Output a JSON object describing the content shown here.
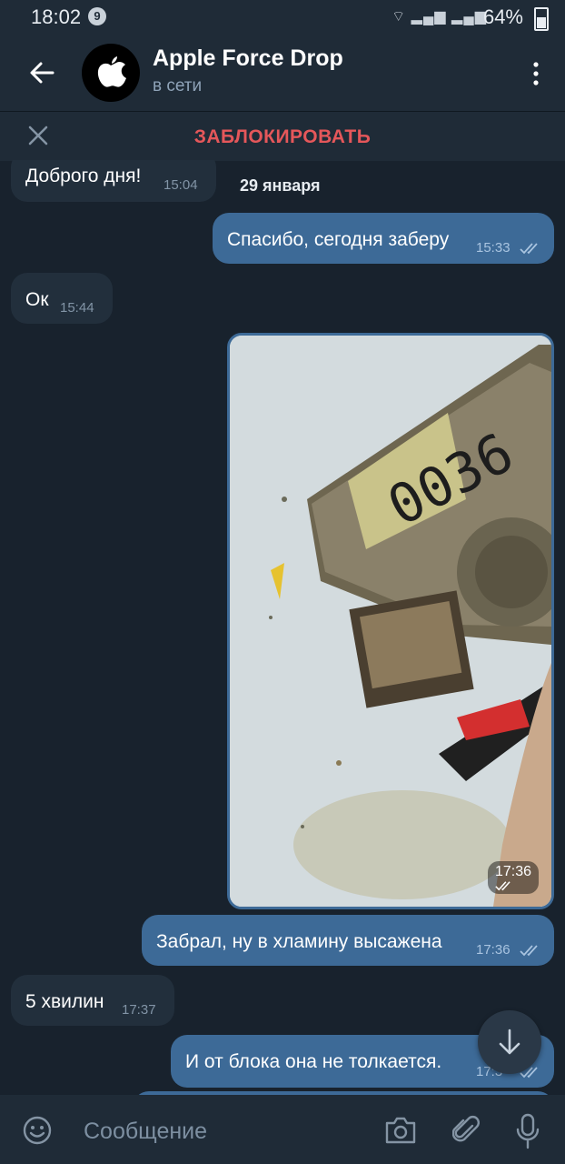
{
  "status_bar": {
    "time": "18:02",
    "notification_count": "9",
    "battery": "64%"
  },
  "header": {
    "title": "Apple Force Drop",
    "status": "в сети"
  },
  "block_bar": {
    "label": "ЗАБЛОКИРОВАТЬ"
  },
  "date_separator": "29 января",
  "messages": [
    {
      "direction": "in",
      "text": "Доброго дня!",
      "time": "15:04"
    },
    {
      "direction": "out",
      "text": "Спасибо, сегодня заберу",
      "time": "15:33",
      "read": true
    },
    {
      "direction": "in",
      "text": "Ок",
      "time": "15:44"
    },
    {
      "direction": "out",
      "type": "photo",
      "time": "17:36",
      "read": true
    },
    {
      "direction": "out",
      "text": "Забрал, ну в хламину высажена",
      "time": "17:36",
      "read": true
    },
    {
      "direction": "in",
      "text": "5 хвилин",
      "time": "17:37"
    },
    {
      "direction": "out",
      "text": "И от блока она не толкается.",
      "time": "17:3",
      "read": true
    }
  ],
  "input": {
    "placeholder": "Сообщение"
  },
  "icons": {
    "back": "arrow-left-icon",
    "menu": "more-vertical-icon",
    "close": "close-icon",
    "scroll": "arrow-down-icon",
    "emoji": "emoji-icon",
    "camera": "camera-icon",
    "attach": "paperclip-icon",
    "mic": "microphone-icon"
  },
  "colors": {
    "background": "#18222d",
    "header": "#1f2b37",
    "incoming": "#222f3c",
    "outgoing": "#3d6a97",
    "danger": "#e5575a"
  }
}
